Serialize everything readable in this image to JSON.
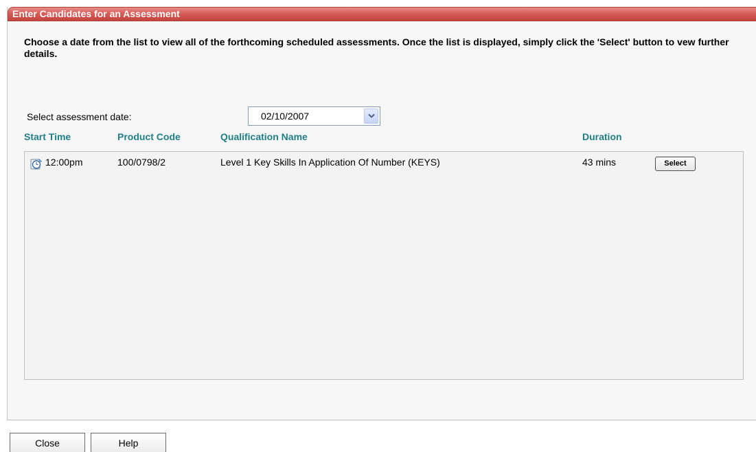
{
  "panel": {
    "title": "Enter Candidates for an Assessment",
    "intro": "Choose a date from the list to view all of the forthcoming scheduled assessments. Once the list is displayed, simply click the 'Select' button to vew further details."
  },
  "date_selector": {
    "label": "Select assessment date:",
    "selected_value": "02/10/2007",
    "arrow_icon": "chevron-down-icon"
  },
  "table": {
    "headers": {
      "start_time": "Start Time",
      "product_code": "Product Code",
      "qualification_name": "Qualification Name",
      "duration": "Duration"
    },
    "rows": [
      {
        "icon": "clock-icon",
        "start_time": "12:00pm",
        "product_code": "100/0798/2",
        "qualification_name": "Level 1 Key Skills In Application Of Number (KEYS)",
        "duration": "43 mins",
        "action_label": "Select"
      }
    ]
  },
  "footer": {
    "close_label": "Close",
    "help_label": "Help"
  },
  "colors": {
    "title_bar": "#d65c57",
    "header_text": "#1f7f86",
    "panel_bg": "#f7f7f7",
    "list_bg": "#f3f3f3"
  }
}
